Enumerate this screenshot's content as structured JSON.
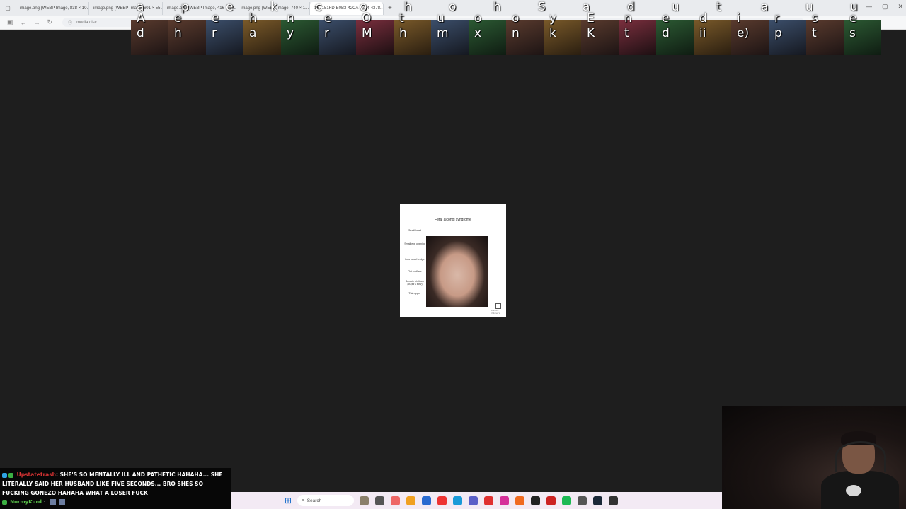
{
  "browser": {
    "tabs": [
      {
        "label": "image.png (WEBP Image, 838 × 10..."
      },
      {
        "label": "image.png (WEBP Image, 601 × 55..."
      },
      {
        "label": "image.png (WEBP Image, 416 × 10..."
      },
      {
        "label": "image.png (WEBP Image, 740 × 1..."
      },
      {
        "label": "1B7151FD-B0B3-42CA-8724-4378...",
        "active": true
      }
    ],
    "new_tab_label": "+",
    "address": "media.disc",
    "close_glyph": "×"
  },
  "overlay": {
    "letters_row1": [
      "a",
      "p",
      "e",
      "k",
      "c",
      "o",
      "h",
      "o",
      "h",
      "S",
      "a",
      "d",
      "u",
      "t",
      "a",
      "u",
      "u"
    ],
    "letters_row2": [
      "A",
      "e",
      "e",
      "h",
      "n",
      "e",
      "O",
      "t",
      "u",
      "o",
      "o",
      "y",
      "E",
      "n",
      "e",
      "d",
      "i",
      "r",
      "s",
      "e"
    ],
    "letters_row3": [
      "d",
      "h",
      "r",
      "a",
      "y",
      "r",
      "M",
      "h",
      "m",
      "x",
      "n",
      "k",
      "K",
      "t",
      "d",
      "ii",
      "e)",
      "p",
      "t",
      "s"
    ]
  },
  "image": {
    "title": "Fetal alcohol syndrome",
    "labels": [
      "Small head",
      "Small eye opening",
      "Low nasal bridge",
      "Flat midface",
      "Smooth philtrum (cupid's bow)",
      "Thin upper"
    ],
    "watermark": "Stanford Children's"
  },
  "chat": {
    "msg1_user": "Upstatetrash",
    "msg1_text": ": SHE'S SO MENTALLY ILL AND PATHETIC HAHAHA... SHE LITERALLY SAID HER HUSBAND LIKE FIVE SECONDS... BRO SHES SO FUCKING GONEZO HAHAHA WHAT A LOSER FUCK",
    "msg2_user": "NormyKurd",
    "msg2_text": ":"
  },
  "taskbar": {
    "search_placeholder": "Search",
    "app_colors": [
      "#8a7f6a",
      "#555",
      "#e66",
      "#f0a020",
      "#2a6ad0",
      "#e33",
      "#1a9ad8",
      "#5b5fc7",
      "#e03030",
      "#d6309a",
      "#f06a20",
      "#222",
      "#c22",
      "#1db954",
      "#555",
      "#1b2838",
      "#333"
    ]
  }
}
